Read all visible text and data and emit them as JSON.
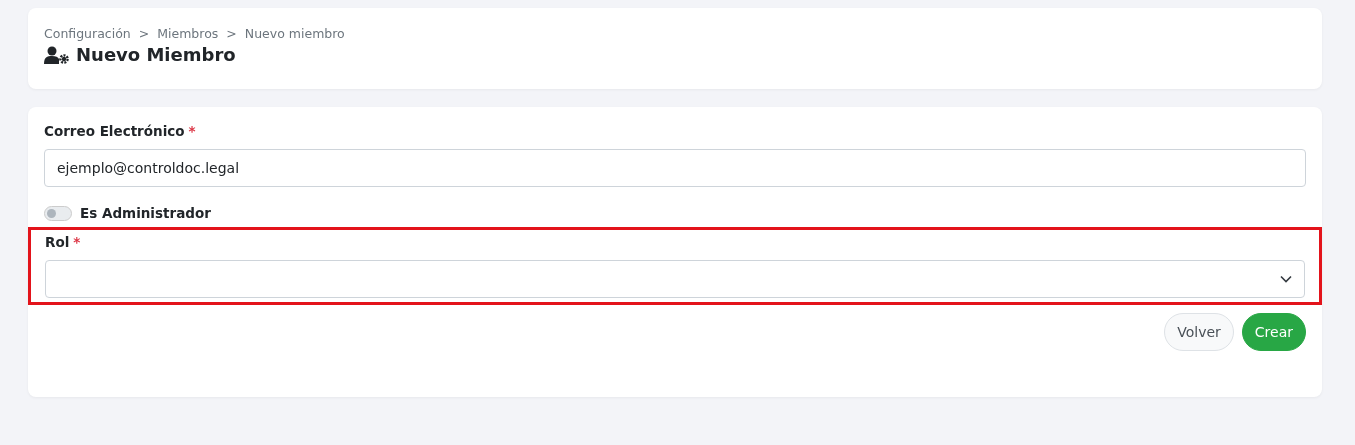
{
  "breadcrumb": [
    "Configuración",
    "Miembros",
    "Nuevo miembro"
  ],
  "breadcrumb_separator": ">",
  "title": "Nuevo Miembro",
  "form": {
    "email": {
      "label": "Correo Electrónico",
      "required_mark": "*",
      "value": "ejemplo@controldoc.legal"
    },
    "admin_toggle": {
      "label": "Es Administrador",
      "on": false
    },
    "role": {
      "label": "Rol",
      "required_mark": "*",
      "highlighted": true
    },
    "buttons": [
      {
        "label": "Volver",
        "kind": "secondary"
      },
      {
        "label": "Crear",
        "kind": "primary"
      }
    ]
  }
}
